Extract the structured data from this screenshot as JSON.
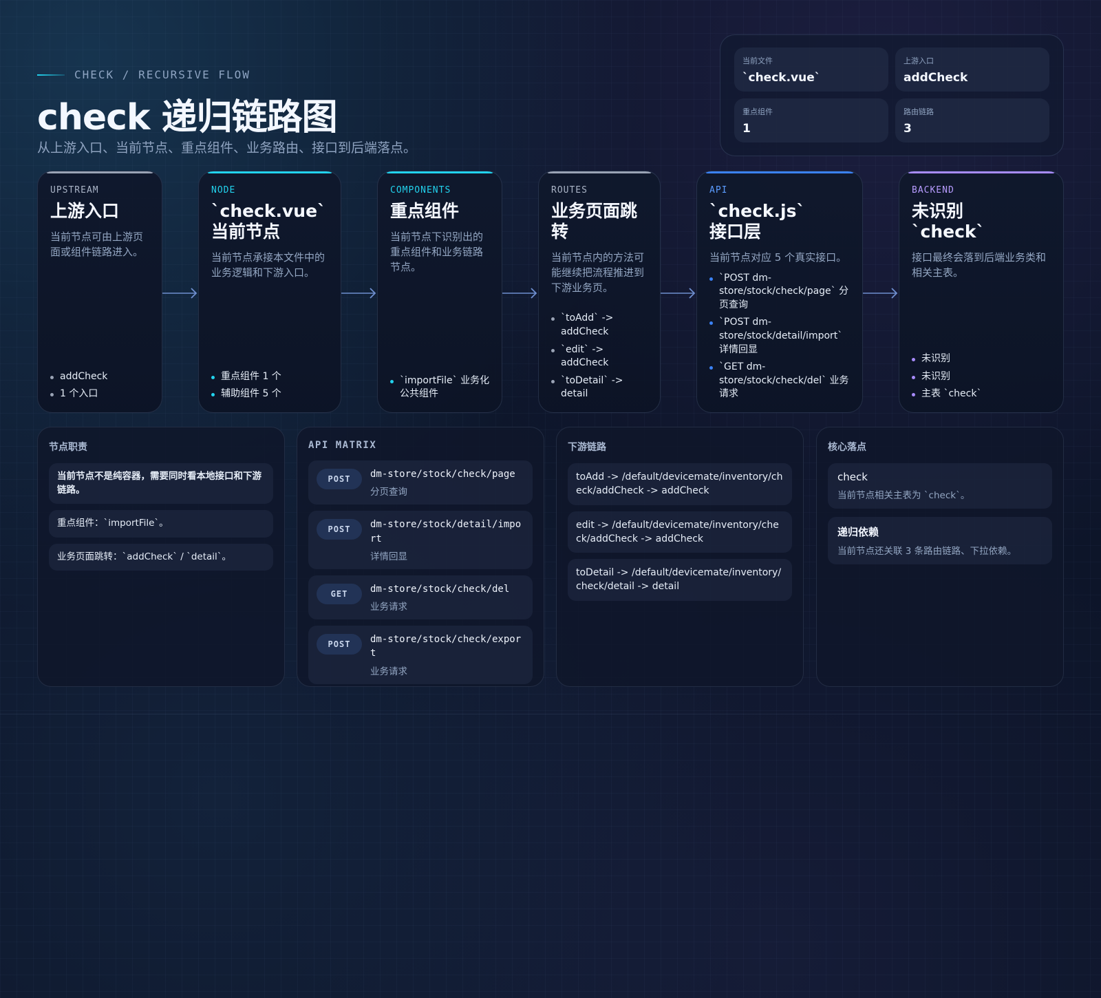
{
  "header": {
    "eyebrow": "CHECK / RECURSIVE FLOW",
    "title": "check 递归链路图",
    "subtitle": "从上游入口、当前节点、重点组件、业务路由、接口到后端落点。"
  },
  "stats": [
    {
      "label": "当前文件",
      "value": "`check.vue`"
    },
    {
      "label": "上游入口",
      "value": "addCheck"
    },
    {
      "label": "重点组件",
      "value": "1"
    },
    {
      "label": "路由链路",
      "value": "3"
    }
  ],
  "colors": {
    "upstream": "#9aa3b5",
    "node": "#22d3ee",
    "components": "#22d3ee",
    "routes": "#9aa3b5",
    "api": "#3b82f6",
    "backend": "#a78bfa"
  },
  "flow": [
    {
      "tag": "UPSTREAM",
      "title": "上游入口",
      "desc": "当前节点可由上游页面或组件链路进入。",
      "items": [
        "addCheck",
        "1 个入口"
      ]
    },
    {
      "tag": "NODE",
      "title": "`check.vue`\n当前节点",
      "desc": "当前节点承接本文件中的业务逻辑和下游入口。",
      "items": [
        "重点组件 1 个",
        "辅助组件 5 个"
      ]
    },
    {
      "tag": "COMPONENTS",
      "title": "重点组件",
      "desc": "当前节点下识别出的重点组件和业务链路节点。",
      "items": [
        "`importFile` 业务化公共组件"
      ]
    },
    {
      "tag": "ROUTES",
      "title": "业务页面跳\n转",
      "desc": "当前节点内的方法可能继续把流程推进到下游业务页。",
      "items": [
        "`toAdd` -> addCheck",
        "`edit` -> addCheck",
        "`toDetail` -> detail"
      ]
    },
    {
      "tag": "API",
      "title": "`check.js`\n接口层",
      "desc": "当前节点对应 5 个真实接口。",
      "items": [
        "`POST dm-store/stock/check/page` 分页查询",
        "`POST dm-store/stock/detail/import` 详情回显",
        "`GET dm-store/stock/check/del` 业务请求"
      ]
    },
    {
      "tag": "BACKEND",
      "title": "未识别\n`check`",
      "desc": "接口最终会落到后端业务类和相关主表。",
      "items": [
        "未识别",
        "未识别",
        "主表 `check`"
      ]
    }
  ],
  "responsibilities": {
    "title": "节点职责",
    "items": [
      "当前节点不是纯容器，需要同时看本地接口和下游链路。",
      "重点组件：`importFile`。",
      "业务页面跳转：`addCheck` / `detail`。"
    ]
  },
  "api_matrix": {
    "title": "API MATRIX",
    "items": [
      {
        "method": "POST",
        "path": "dm-store/stock/check/page",
        "desc": "分页查询"
      },
      {
        "method": "POST",
        "path": "dm-store/stock/detail/import",
        "desc": "详情回显"
      },
      {
        "method": "GET",
        "path": "dm-store/stock/check/del",
        "desc": "业务请求"
      },
      {
        "method": "POST",
        "path": "dm-store/stock/check/export",
        "desc": "业务请求"
      }
    ]
  },
  "downstream": {
    "title": "下游链路",
    "items": [
      "toAdd -> /default/devicemate/inventory/check/addCheck -> addCheck",
      "edit -> /default/devicemate/inventory/check/addCheck -> addCheck",
      "toDetail -> /default/devicemate/inventory/check/detail -> detail"
    ]
  },
  "core": {
    "title": "核心落点",
    "items": [
      {
        "title": "check",
        "desc": "当前节点相关主表为 `check`。"
      },
      {
        "title": "递归依赖",
        "desc": "当前节点还关联 3 条路由链路、下拉依赖。"
      }
    ]
  }
}
